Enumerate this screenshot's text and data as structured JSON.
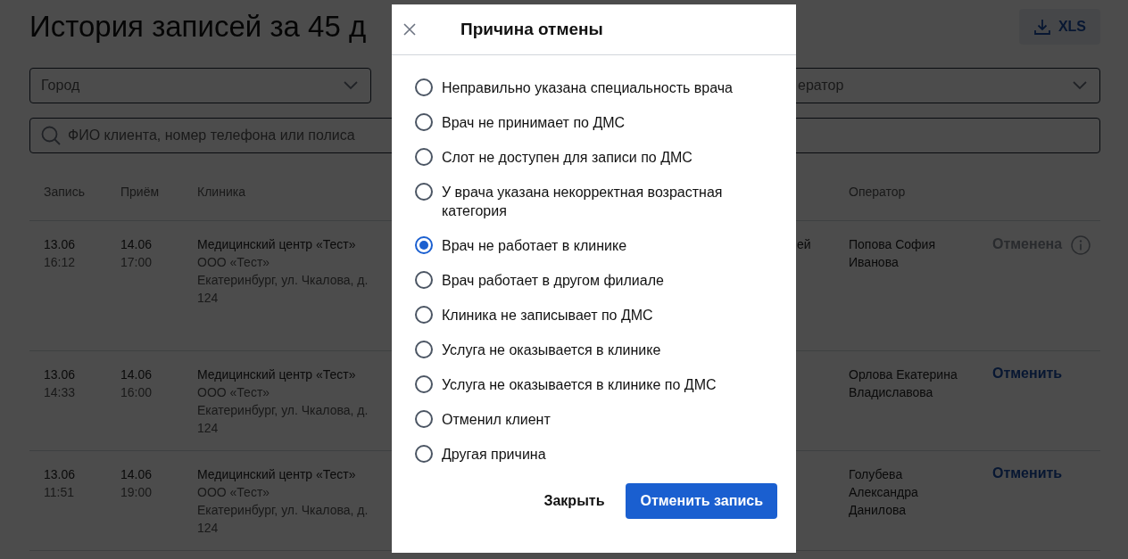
{
  "page": {
    "title": "История записей за 45 д",
    "export_button": "XLS"
  },
  "filters": [
    {
      "placeholder": "Город"
    },
    {
      "placeholder": "ератор"
    }
  ],
  "search": {
    "placeholder": "ФИО клиента, номер телефона или полиса"
  },
  "table": {
    "columns": {
      "record": "Запись",
      "visit": "Приём",
      "clinic": "Клиника",
      "operator": "Оператор"
    },
    "rows": [
      {
        "record_date": "13.06",
        "record_time": "16:12",
        "visit_date": "14.06",
        "visit_time": "17:00",
        "clinic_name": "Медицинский центр «Тест»",
        "clinic_org": "ООО «Тест»",
        "clinic_address": "Екатеринбург, ул. Чкалова, д. 124",
        "column_4": "ей",
        "operator": "Попова София Иванова",
        "cancelled": true,
        "action": "Отменена"
      },
      {
        "record_date": "13.06",
        "record_time": "14:33",
        "visit_date": "14.06",
        "visit_time": "16:00",
        "clinic_name": "Медицинский центр «Тест»",
        "clinic_org": "ООО «Тест»",
        "clinic_address": "Екатеринбург, ул. Чкалова, д. 124",
        "operator": "Орлова Екатерина Владиславова",
        "cancelled": false,
        "action": "Отменить"
      },
      {
        "record_date": "13.06",
        "record_time": "11:51",
        "visit_date": "14.06",
        "visit_time": "19:00",
        "clinic_name": "Медицинский центр «Тест»",
        "clinic_org": "ООО «Тест»",
        "clinic_address": "Екатеринбург, ул. Чкалова, д. 124",
        "operator": "Голубева Александра Данилова",
        "cancelled": false,
        "action": "Отменить"
      }
    ]
  },
  "modal": {
    "title": "Причина отмены",
    "options": [
      {
        "label": "Неправильно указана специальность врача",
        "selected": false
      },
      {
        "label": "Врач не принимает по ДМС",
        "selected": false
      },
      {
        "label": "Слот не доступен для записи по ДМС",
        "selected": false
      },
      {
        "label": "У врача указана некорректная возрастная категория",
        "selected": false
      },
      {
        "label": "Врач не работает в клинике",
        "selected": true
      },
      {
        "label": "Врач работает в другом филиале",
        "selected": false
      },
      {
        "label": "Клиника не записывает по ДМС",
        "selected": false
      },
      {
        "label": "Услуга не оказывается в клинике",
        "selected": false
      },
      {
        "label": "Услуга не оказывается в клинике по ДМС",
        "selected": false
      },
      {
        "label": "Отменил клиент",
        "selected": false
      },
      {
        "label": "Другая причина",
        "selected": false
      }
    ],
    "close_button": "Закрыть",
    "submit_button": "Отменить запись"
  }
}
